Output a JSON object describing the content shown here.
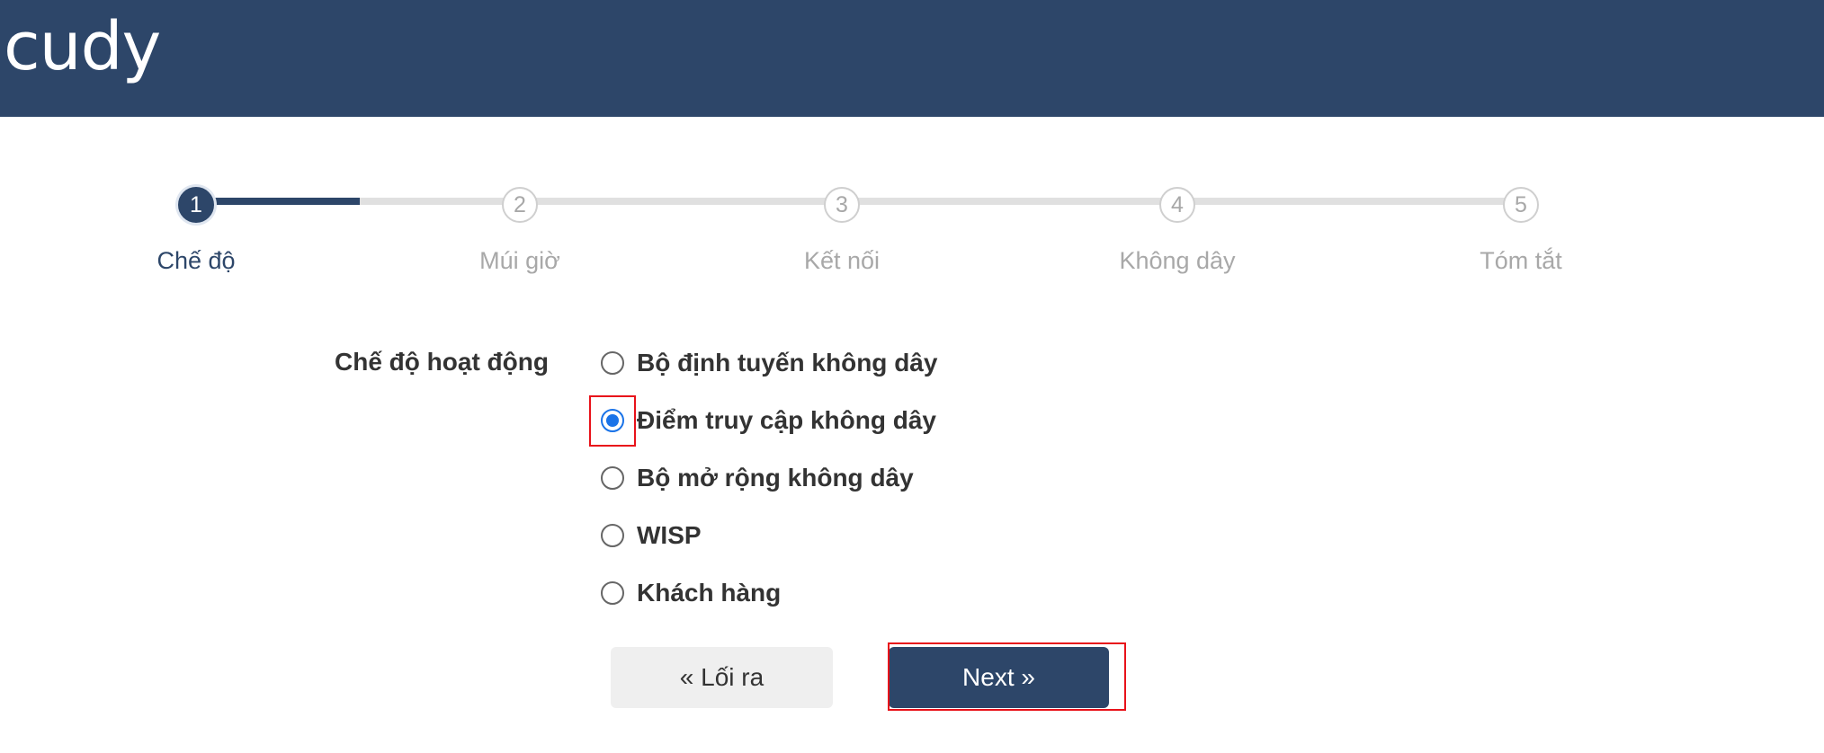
{
  "header": {
    "logo_text": "cudy"
  },
  "stepper": {
    "steps": [
      {
        "number": "1",
        "label": "Chế độ"
      },
      {
        "number": "2",
        "label": "Múi giờ"
      },
      {
        "number": "3",
        "label": "Kết nối"
      },
      {
        "number": "4",
        "label": "Không dây"
      },
      {
        "number": "5",
        "label": "Tóm tắt"
      }
    ],
    "current_step": 1,
    "progress_fraction": 0.16
  },
  "form": {
    "label": "Chế độ hoạt động",
    "options": [
      {
        "label": "Bộ định tuyến không dây",
        "checked": false
      },
      {
        "label": "Điểm truy cập không dây",
        "checked": true
      },
      {
        "label": "Bộ mở rộng không dây",
        "checked": false
      },
      {
        "label": "WISP",
        "checked": false
      },
      {
        "label": "Khách hàng",
        "checked": false
      }
    ]
  },
  "buttons": {
    "back_label": "« Lối ra",
    "next_label": "Next »"
  },
  "colors": {
    "brand": "#2d4669",
    "radio_checked": "#1a73e8",
    "highlight": "#e8121a"
  }
}
